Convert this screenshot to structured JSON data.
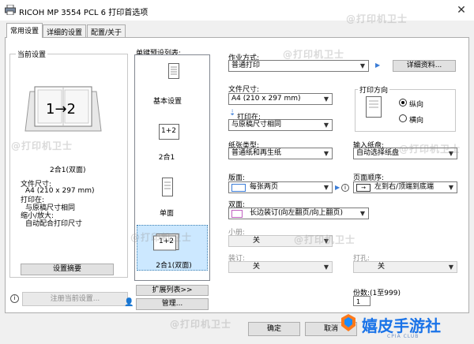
{
  "window": {
    "title": "RICOH MP 3554 PCL 6 打印首选项",
    "close_glyph": "✕"
  },
  "tabs": [
    {
      "label": "常用设置",
      "active": true
    },
    {
      "label": "详细的设置",
      "active": false
    },
    {
      "label": "配置/关于",
      "active": false
    }
  ],
  "current_settings": {
    "group_label": "当前设置",
    "preview_text": "1→2",
    "preview_caption": "2合1(双面)",
    "lines": [
      "文件尺寸:",
      "A4 (210 x 297 mm)",
      "打印在:",
      "与原稿尺寸相同",
      "缩小/放大:",
      "自动配合打印尺寸"
    ],
    "summary_button": "设置摘要",
    "register_button": "注册当前设置..."
  },
  "one_click": {
    "label": "单键预设列表:",
    "items": [
      {
        "label": "基本设置",
        "icon": "document-icon"
      },
      {
        "label": "2合1",
        "icon": "two-in-one-icon",
        "icon_text": "1+2"
      },
      {
        "label": "单面",
        "icon": "single-sided-icon"
      },
      {
        "label": "2合1(双面)",
        "icon": "two-in-one-duplex-icon",
        "icon_text": "1+2",
        "selected": true
      }
    ],
    "expand_button": "扩展列表>>",
    "manage_button": "管理..."
  },
  "job_type": {
    "label": "作业方式:",
    "value": "普通打印",
    "details_button": "详细资料..."
  },
  "document_size": {
    "label": "文件尺寸:",
    "value": "A4 (210 x 297 mm)"
  },
  "print_on": {
    "label": "打印在:",
    "value": "与原稿尺寸相同"
  },
  "orientation": {
    "label": "打印方向",
    "options": [
      {
        "label": "纵向",
        "selected": true
      },
      {
        "label": "横向",
        "selected": false
      }
    ]
  },
  "paper_type": {
    "label": "纸张类型:",
    "value": "普通纸和再生纸"
  },
  "input_tray": {
    "label": "输入纸盘:",
    "value": "自动选择纸盘"
  },
  "layout": {
    "label": "版面:",
    "value": "每张两页"
  },
  "page_order": {
    "label": "页面顺序:",
    "value": "左到右/顶端到底端"
  },
  "duplex": {
    "label": "双面:",
    "value": "长边装订(向左翻页/向上翻页)"
  },
  "booklet": {
    "label": "小册:",
    "value": "关"
  },
  "staple": {
    "label": "装订:",
    "value": "关"
  },
  "punch": {
    "label": "打孔:",
    "value": "关"
  },
  "copies": {
    "label": "份数:(1至999)",
    "value": "1"
  },
  "footer": {
    "ok_button": "确定",
    "cancel_button": "取消"
  },
  "watermark_text": "@打印机卫士",
  "brand": {
    "name": "嬉皮手游社",
    "sub": "CPIA CLUB"
  }
}
